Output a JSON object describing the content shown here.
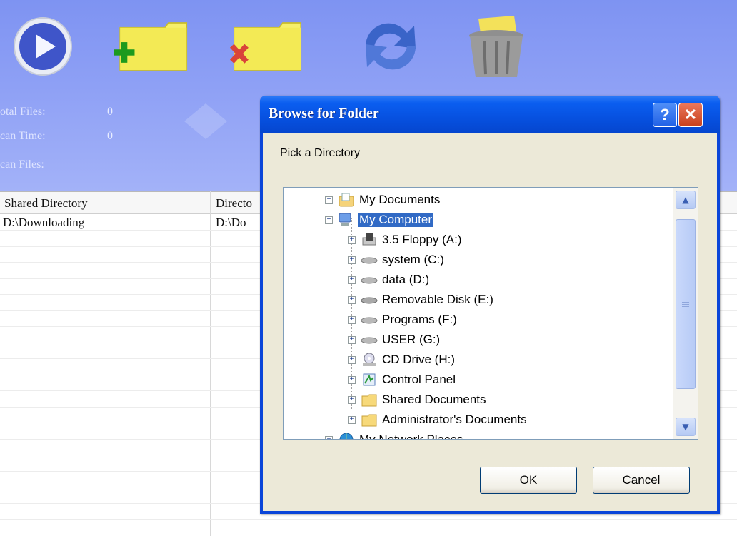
{
  "app": {
    "stats": {
      "total_files_label": "otal Files:",
      "total_files_value": "0",
      "scan_time_label": "can Time:",
      "scan_time_value": "0",
      "scan_files_label": "can Files:"
    },
    "table": {
      "columns": [
        "Shared Directory",
        "Directo"
      ],
      "rows": [
        [
          "D:\\Downloading",
          "D:\\Do"
        ]
      ]
    }
  },
  "dialog": {
    "title": "Browse for Folder",
    "help_glyph": "?",
    "close_glyph": "✕",
    "prompt": "Pick a Directory",
    "tree": [
      {
        "label": "My Documents",
        "icon": "documents-folder-icon",
        "expander": "+"
      },
      {
        "label": "My Computer",
        "icon": "computer-icon",
        "expander": "−",
        "selected": true
      },
      {
        "label": "3.5 Floppy (A:)",
        "icon": "floppy-drive-icon",
        "expander": "+"
      },
      {
        "label": "system (C:)",
        "icon": "hard-drive-icon",
        "expander": "+"
      },
      {
        "label": "data (D:)",
        "icon": "hard-drive-icon",
        "expander": "+"
      },
      {
        "label": "Removable Disk (E:)",
        "icon": "removable-drive-icon",
        "expander": "+"
      },
      {
        "label": "Programs (F:)",
        "icon": "hard-drive-icon",
        "expander": "+"
      },
      {
        "label": "USER (G:)",
        "icon": "hard-drive-icon",
        "expander": "+"
      },
      {
        "label": "CD Drive (H:)",
        "icon": "cd-drive-icon",
        "expander": "+"
      },
      {
        "label": "Control Panel",
        "icon": "control-panel-icon",
        "expander": "+"
      },
      {
        "label": "Shared Documents",
        "icon": "folder-icon",
        "expander": "+"
      },
      {
        "label": "Administrator's Documents",
        "icon": "folder-icon",
        "expander": "+"
      },
      {
        "label": "My Network Places",
        "icon": "network-places-icon",
        "expander": "+"
      }
    ],
    "scroll_up": "▲",
    "scroll_down": "▼",
    "ok_label": "OK",
    "cancel_label": "Cancel"
  }
}
